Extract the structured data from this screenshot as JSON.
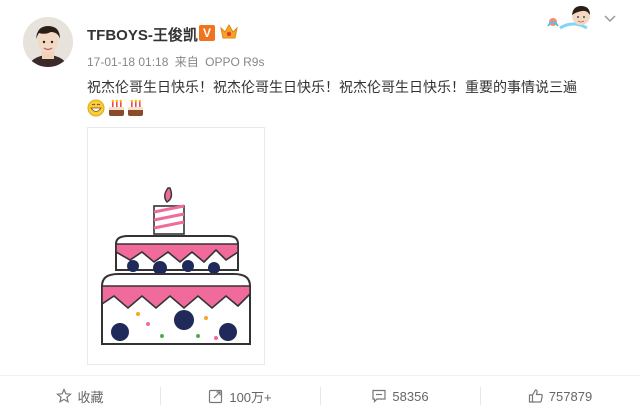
{
  "user": {
    "name": "TFBOYS-王俊凯",
    "verified_label": "V"
  },
  "meta": {
    "time": "17-01-18 01:18",
    "source_prefix": "来自",
    "source": "OPPO R9s"
  },
  "post": {
    "text": "祝杰伦哥生日快乐！祝杰伦哥生日快乐！祝杰伦哥生日快乐！重要的事情说三遍",
    "emojis": [
      "smile-emoji",
      "cake-emoji",
      "cake-emoji"
    ]
  },
  "actions": {
    "favorite": {
      "label": "收藏",
      "icon": "star-icon"
    },
    "repost": {
      "label": "100万+",
      "icon": "repost-icon"
    },
    "comment": {
      "label": "58356",
      "icon": "comment-icon"
    },
    "like": {
      "label": "757879",
      "icon": "thumbs-up-icon"
    }
  },
  "colors": {
    "text": "#333333",
    "meta": "#888888",
    "verified": "#f0731e",
    "cake_pink": "#f06a9c",
    "cake_navy": "#1f2a5a"
  }
}
